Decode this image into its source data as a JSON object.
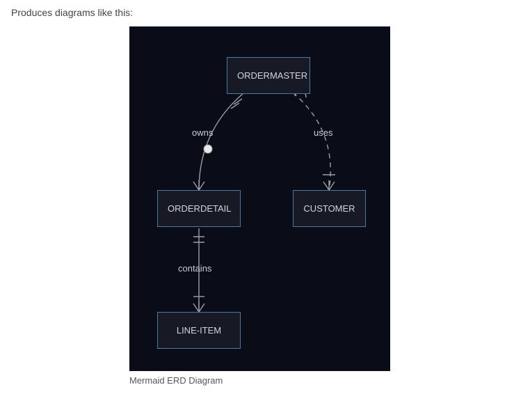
{
  "intro_text": "Produces diagrams like this:",
  "caption": "Mermaid ERD Diagram",
  "entities": {
    "ordermaster": "ORDERMASTER",
    "orderdetail": "ORDERDETAIL",
    "customer": "CUSTOMER",
    "lineitem": "LINE-ITEM"
  },
  "relationships": {
    "owns": "owns",
    "uses": "uses",
    "contains": "contains"
  },
  "chart_data": {
    "type": "erd",
    "title": "Mermaid ERD Diagram",
    "tool": "Mermaid",
    "entities": [
      "ORDERMASTER",
      "ORDERDETAIL",
      "CUSTOMER",
      "LINE-ITEM"
    ],
    "relationships": [
      {
        "from": "ORDERMASTER",
        "to": "ORDERDETAIL",
        "label": "owns",
        "style": "solid",
        "from_cardinality": "exactly-one",
        "to_cardinality": "zero-or-many"
      },
      {
        "from": "ORDERMASTER",
        "to": "CUSTOMER",
        "label": "uses",
        "style": "dashed",
        "from_cardinality": "zero-or-one",
        "to_cardinality": "one-or-many"
      },
      {
        "from": "ORDERDETAIL",
        "to": "LINE-ITEM",
        "label": "contains",
        "style": "solid",
        "from_cardinality": "exactly-one",
        "to_cardinality": "one-or-many"
      }
    ]
  }
}
